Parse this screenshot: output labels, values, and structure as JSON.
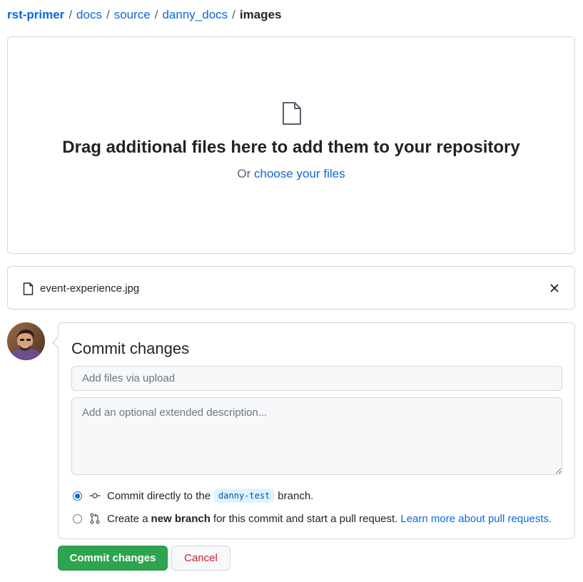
{
  "breadcrumb": {
    "repo": "rst-primer",
    "items": [
      "docs",
      "source",
      "danny_docs"
    ],
    "current": "images",
    "separator": "/"
  },
  "dropzone": {
    "headline": "Drag additional files here to add them to your repository",
    "or_text": "Or",
    "choose_link": "choose your files"
  },
  "file": {
    "name": "event-experience.jpg"
  },
  "commit": {
    "title": "Commit changes",
    "summary_placeholder": "Add files via upload",
    "description_placeholder": "Add an optional extended description...",
    "option1": {
      "prefix": "Commit directly to the",
      "branch": "danny-test",
      "suffix": "branch.",
      "selected": true
    },
    "option2": {
      "prefix": "Create a",
      "bold": "new branch",
      "suffix": "for this commit and start a pull request.",
      "link": "Learn more about pull requests.",
      "selected": false
    },
    "submit_label": "Commit changes",
    "cancel_label": "Cancel"
  },
  "colors": {
    "link": "#0969da",
    "primary_button": "#2da44e",
    "danger": "#cf222e",
    "border": "#d0d7de"
  },
  "icons": {
    "dropzone": "file-icon",
    "file_row": "file-icon",
    "remove": "x-icon",
    "commit_direct": "git-commit-icon",
    "new_branch": "git-pull-request-icon"
  }
}
